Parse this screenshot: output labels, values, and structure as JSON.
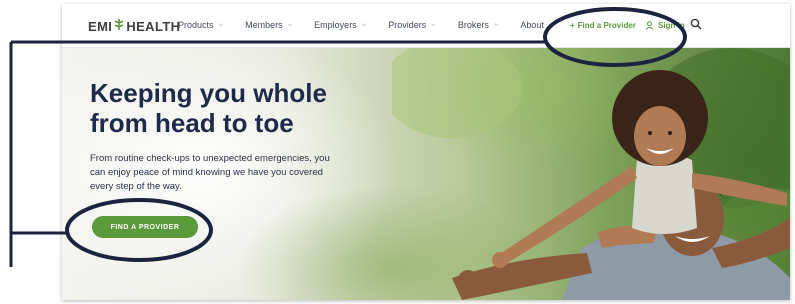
{
  "logo": {
    "text_left": "EMI",
    "text_right": "HEALTH"
  },
  "nav": [
    {
      "label": "Products"
    },
    {
      "label": "Members"
    },
    {
      "label": "Employers"
    },
    {
      "label": "Providers"
    },
    {
      "label": "Brokers"
    },
    {
      "label": "About"
    }
  ],
  "header_actions": {
    "find_provider": "Find a Provider",
    "sign_in": "Sign In"
  },
  "hero": {
    "headline_line1": "Keeping you whole",
    "headline_line2": "from head to toe",
    "subtext": "From routine check-ups to unexpected emergencies, you can enjoy peace of mind knowing we have you covered every step of the way.",
    "cta_label": "FIND A PROVIDER"
  },
  "colors": {
    "brand_green": "#5a9a3a",
    "headline_navy": "#1f2a4a",
    "annotation": "#1c2340"
  }
}
